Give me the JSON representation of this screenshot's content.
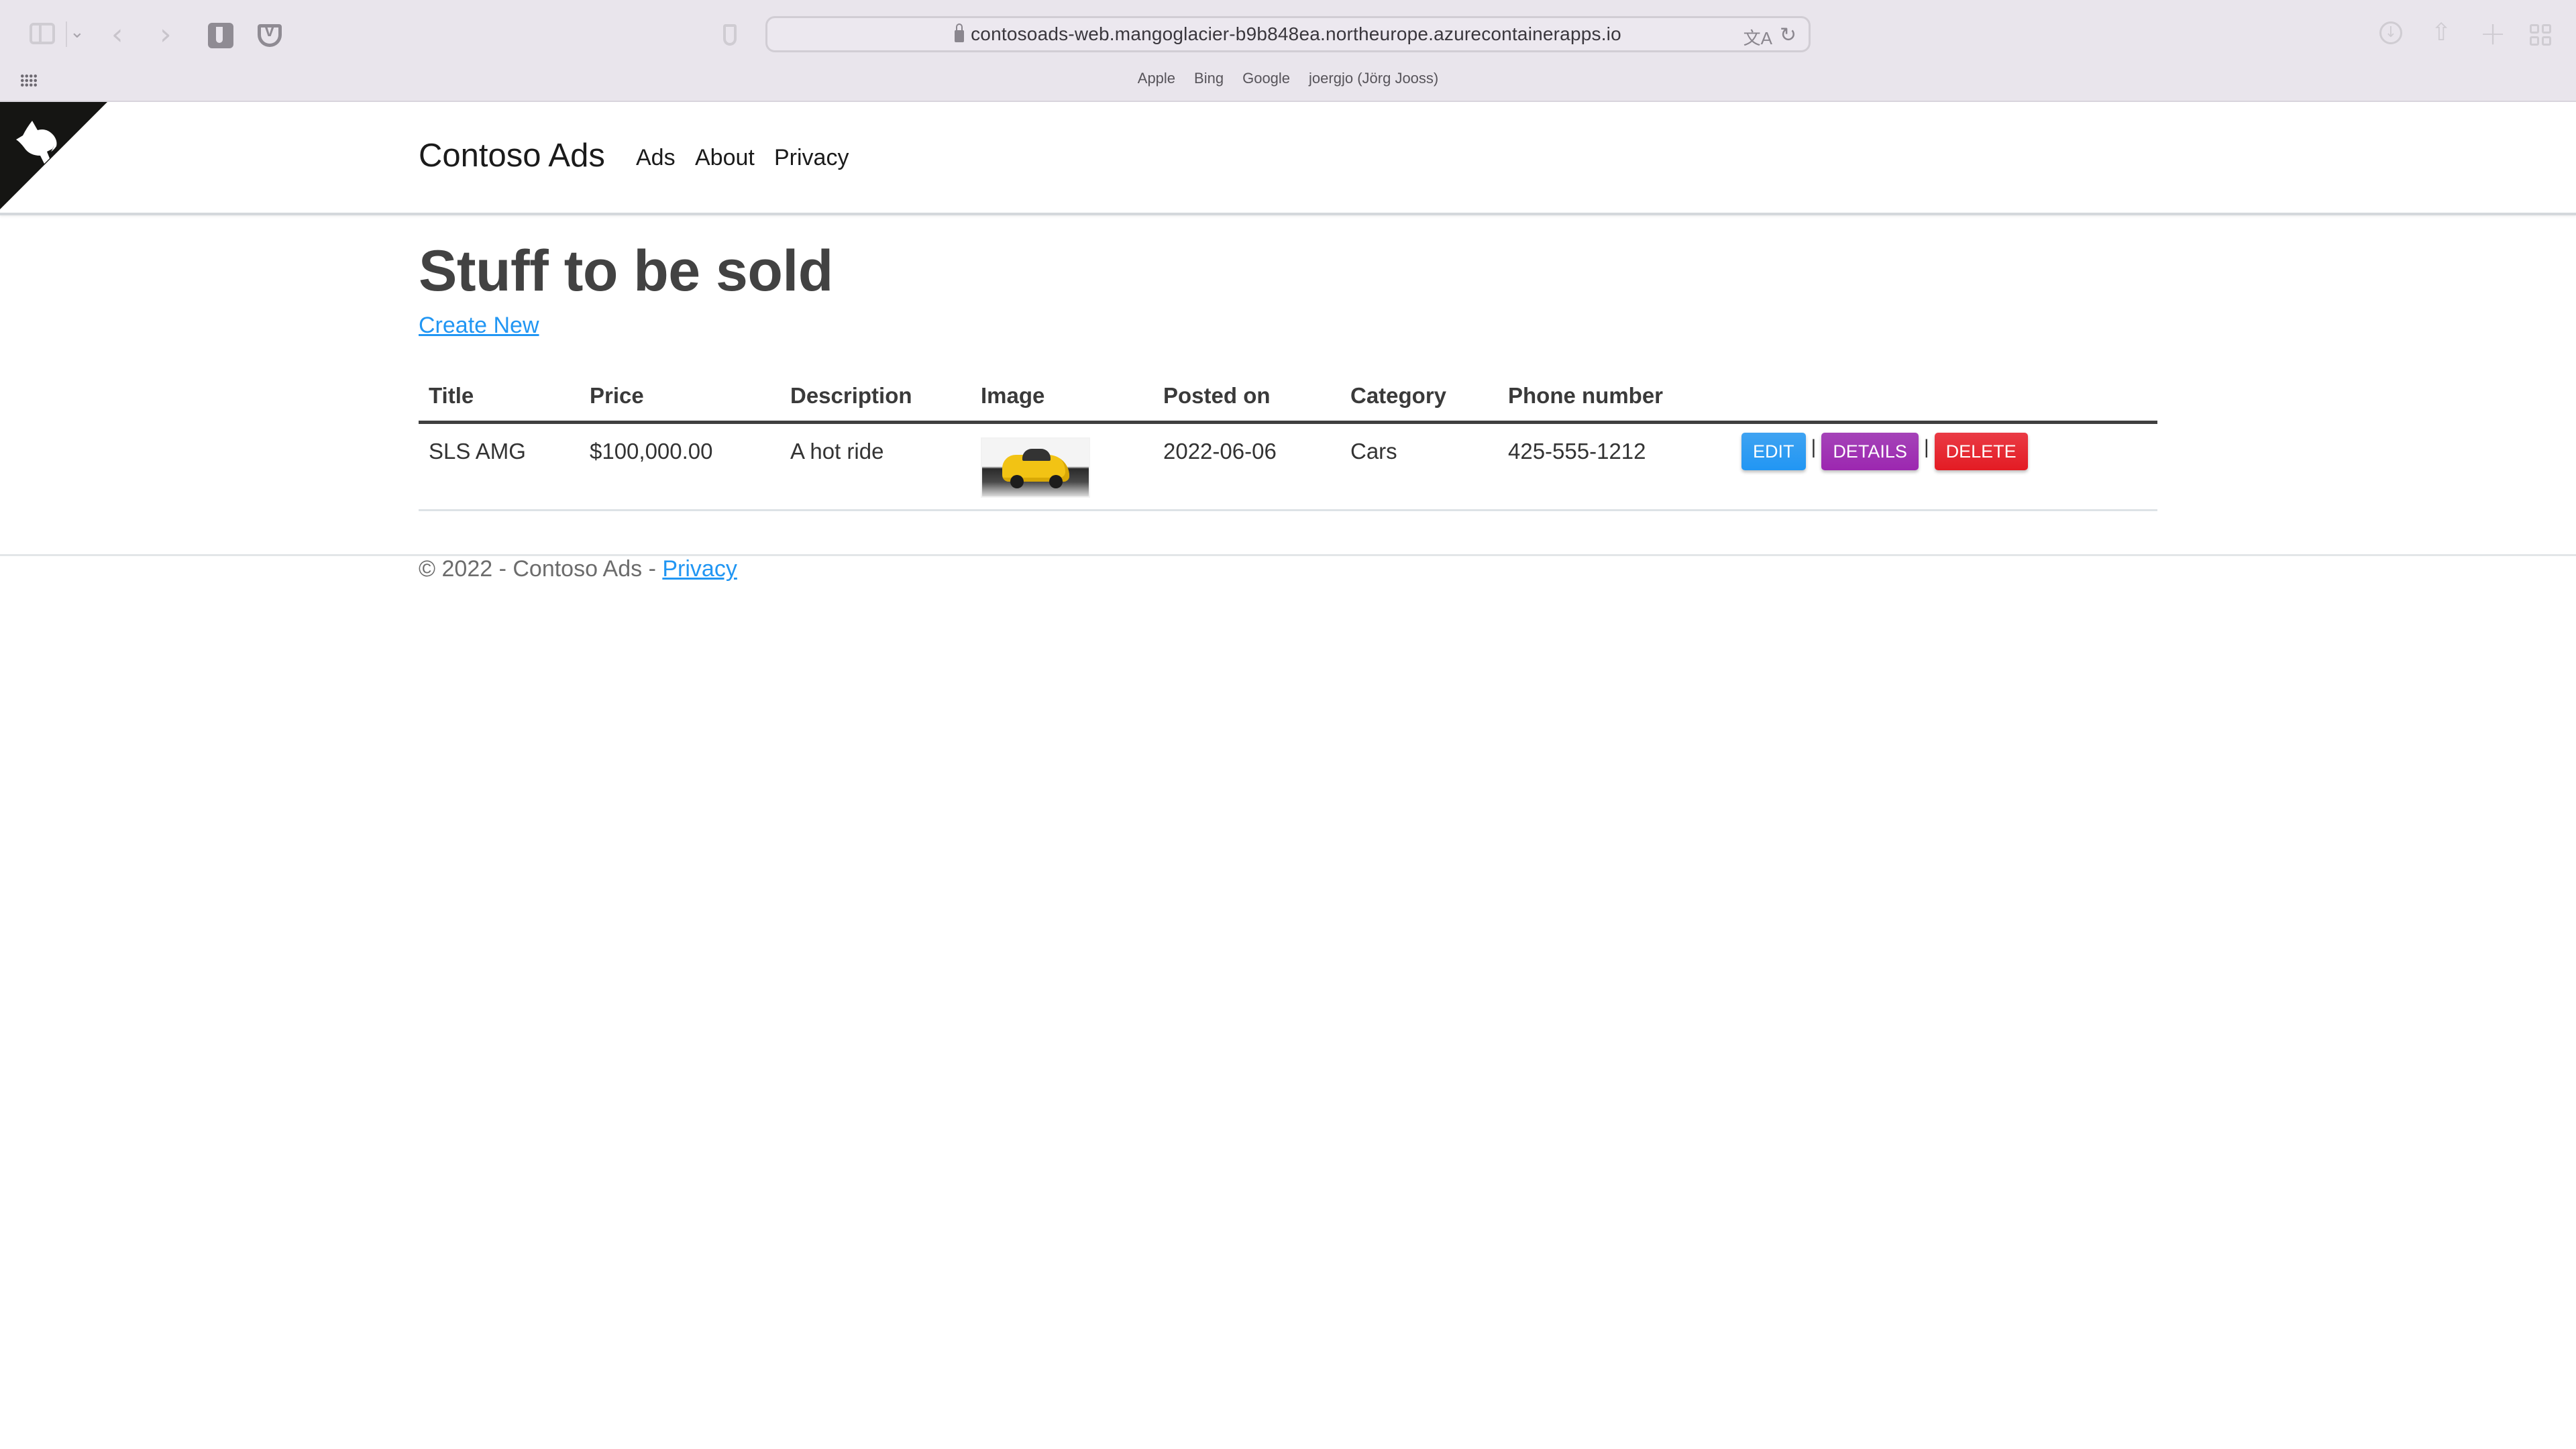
{
  "browser": {
    "url": "contosoads-web.mangoglacier-b9b848ea.northeurope.azurecontainerapps.io",
    "bookmarks": [
      "Apple",
      "Bing",
      "Google",
      "joergjo (Jörg Jooss)"
    ],
    "icons": {
      "sidebar": "sidebar-icon",
      "back": "‹",
      "forward": "›",
      "reload": "↻",
      "translate": "文A",
      "download": "↓",
      "share": "⇧",
      "new_tab": "+"
    }
  },
  "site": {
    "brand": "Contoso Ads",
    "nav": [
      {
        "label": "Ads"
      },
      {
        "label": "About"
      },
      {
        "label": "Privacy"
      }
    ]
  },
  "main": {
    "title": "Stuff to be sold",
    "create_new": "Create New",
    "table": {
      "columns": [
        "Title",
        "Price",
        "Description",
        "Image",
        "Posted on",
        "Category",
        "Phone number"
      ],
      "rows": [
        {
          "title": "SLS AMG",
          "price": "$100,000.00",
          "description": "A hot ride",
          "image": "yellow sports car thumbnail",
          "posted_on": "2022-06-06",
          "category": "Cars",
          "phone": "425-555-1212",
          "actions": {
            "edit": "Edit",
            "details": "Details",
            "delete": "Delete",
            "separator": "|"
          }
        }
      ]
    }
  },
  "footer": {
    "text": "© 2022 - Contoso Ads - ",
    "privacy_link": "Privacy"
  },
  "colors": {
    "link": "#2196f3",
    "edit": "#2196f3",
    "details": "#9c27b0",
    "delete": "#e31b23",
    "chrome_bg": "#e9e5ec"
  }
}
